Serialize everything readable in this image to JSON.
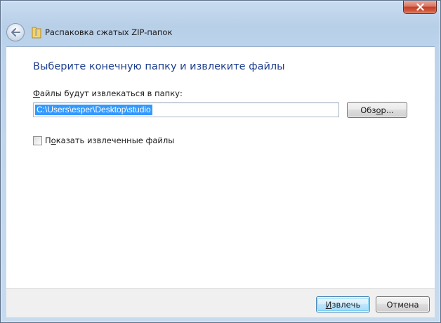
{
  "window": {
    "title": "Распаковка сжатых ZIP-папок",
    "close_label": "✕"
  },
  "icons": {
    "back": "back-arrow-icon",
    "zip": "zip-folder-icon",
    "close": "close-icon"
  },
  "main": {
    "heading": "Выберите конечную папку и извлеките файлы",
    "path_label_prefix": "Ф",
    "path_label_rest": "айлы будут извлекаться в папку:",
    "path_value": "C:\\Users\\esper\\Desktop\\studio",
    "browse_prefix": "Обз",
    "browse_accel": "о",
    "browse_suffix": "р...",
    "show_files_prefix": "П",
    "show_files_accel": "о",
    "show_files_suffix": "казать извлеченные файлы",
    "show_files_checked": false
  },
  "footer": {
    "extract_accel": "И",
    "extract_rest": "звлечь",
    "cancel_label": "Отмена"
  },
  "colors": {
    "heading": "#1e3f8f",
    "selection": "#3399ff",
    "default_button_border": "#3c7fb1"
  }
}
